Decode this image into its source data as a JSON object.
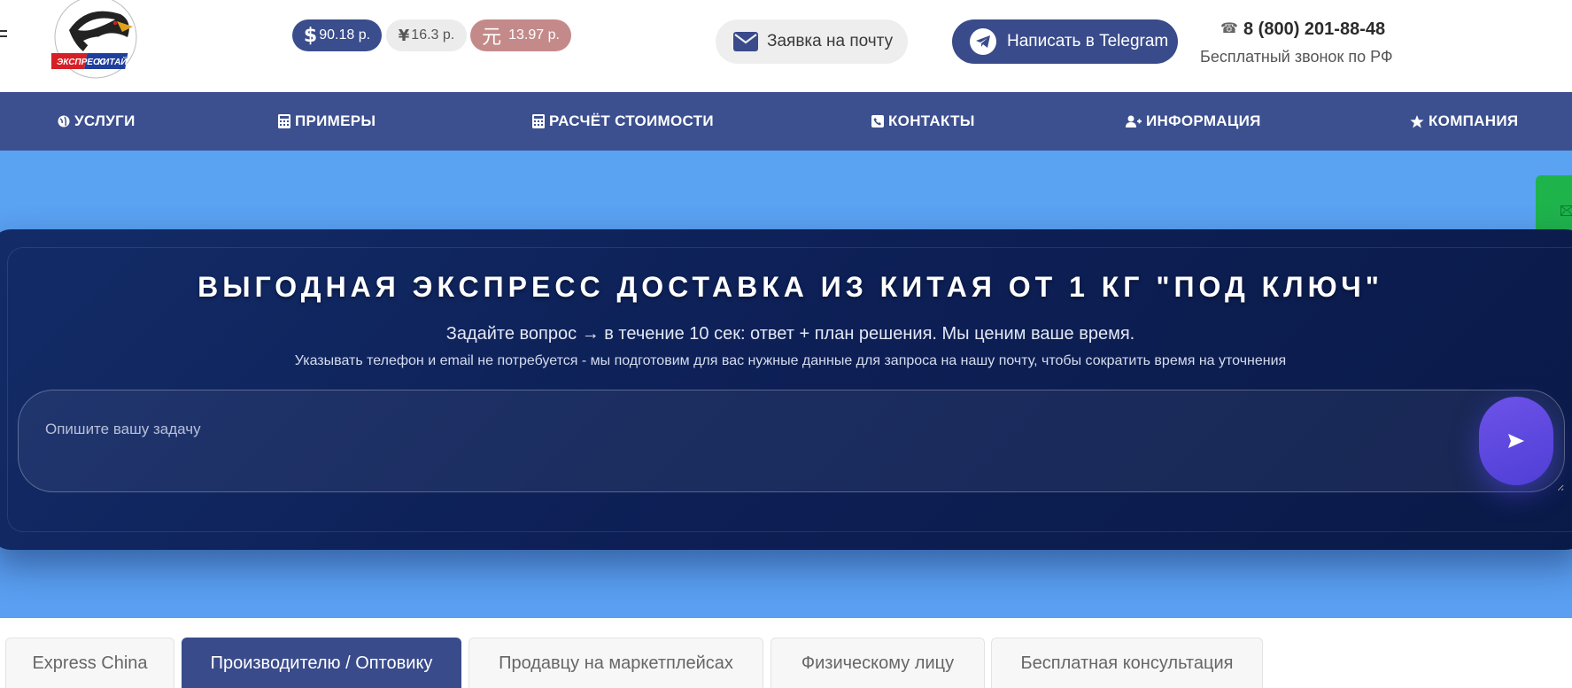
{
  "brand": {
    "logo_text_left": "ЭКСПРЕСС",
    "logo_text_right": "КИТАЙ"
  },
  "rates": {
    "usd": {
      "symbol": "$",
      "value": "90.18 р."
    },
    "cny": {
      "symbol": "¥",
      "value": "16.3 р."
    },
    "rmb": {
      "symbol": "元",
      "value": "13.97 р."
    }
  },
  "header": {
    "mail_button": "Заявка на почту",
    "telegram_button": "Написать в Telegram",
    "phone": "8 (800) 201-88-48",
    "phone_note": "Бесплатный звонок по РФ"
  },
  "nav": {
    "items": [
      {
        "label": "УСЛУГИ",
        "icon": "globe-icon"
      },
      {
        "label": "ПРИМЕРЫ",
        "icon": "calculator-icon"
      },
      {
        "label": "РАСЧЁТ СТОИМОСТИ",
        "icon": "calculator-icon"
      },
      {
        "label": "КОНТАКТЫ",
        "icon": "phone-square-icon"
      },
      {
        "label": "ИНФОРМАЦИЯ",
        "icon": "user-plus-icon"
      },
      {
        "label": "КОМПАНИЯ",
        "icon": "star-icon"
      }
    ]
  },
  "hero": {
    "title": "ВЫГОДНАЯ ЭКСПРЕСС ДОСТАВКА ИЗ КИТАЯ ОТ 1 КГ \"ПОД КЛЮЧ\"",
    "subtitle": "Задайте вопрос → в течение 10 сек: ответ + план решения. Мы ценим ваше время.",
    "note": "Указывать телефон и email не потребуется - мы подготовим для вас нужные данные для запроса на нашу почту, чтобы сократить время на уточнения",
    "input_placeholder": "Опишите вашу задачу",
    "send_icon": "send-arrow-icon"
  },
  "tabs": {
    "items": [
      {
        "label": "Express China",
        "active": false
      },
      {
        "label": "Производителю / Оптовику",
        "active": true
      },
      {
        "label": "Продавцу на маркетплейсах",
        "active": false
      },
      {
        "label": "Физическому лицу",
        "active": false
      },
      {
        "label": "Бесплатная консультация",
        "active": false
      }
    ]
  },
  "colors": {
    "primary": "#394b8a",
    "nav": "#3c4f8f",
    "hero_bg": "#5aa2f2",
    "panel": "#0d1f55",
    "send": "#5a47de",
    "side_tab": "#1fb34c",
    "rmb_badge": "#c48a8a"
  }
}
